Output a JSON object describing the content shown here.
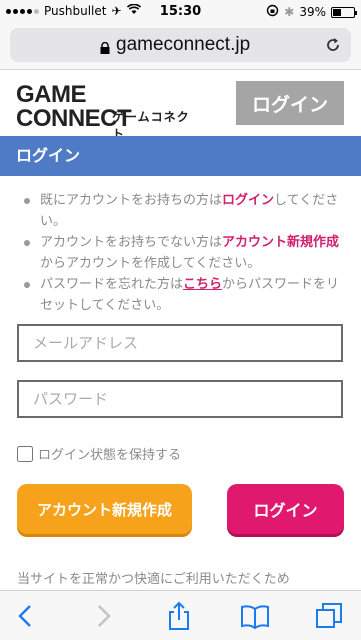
{
  "status_bar": {
    "carrier": "Pushbullet",
    "time": "15:30",
    "battery": "39%",
    "battery_level": 0.39
  },
  "browser": {
    "url": "gameconnect.jp"
  },
  "site": {
    "logo_text": "GAME CONNECT",
    "logo_subtext": "ゲームコネクト",
    "header_login_label": "ログイン"
  },
  "page": {
    "section_title": "ログイン",
    "info": [
      {
        "before": "既にアカウントをお持ちの方は",
        "link": "ログイン",
        "after": "してください。"
      },
      {
        "before": "アカウントをお持ちでない方は",
        "link": "アカウント新規作成",
        "after": "からアカウントを作成してください。"
      },
      {
        "before": "パスワードを忘れた方は",
        "link": "こちら",
        "after": "からパスワードをリセットしてください。"
      }
    ],
    "email_placeholder": "メールアドレス",
    "password_placeholder": "パスワード",
    "remember_label": "ログイン状態を保持する",
    "create_account_label": "アカウント新規作成",
    "login_label": "ログイン",
    "notice": "当サイトを正常かつ快適にご利用いただくため"
  },
  "colors": {
    "title_bar": "#4f7bc6",
    "link": "#d0206f",
    "create_button": "#f6a21b",
    "login_button": "#e0196f",
    "header_login_button": "#a5a5a5"
  },
  "icons": {
    "back": "chevron-left-icon",
    "forward": "chevron-right-icon",
    "share": "share-icon",
    "bookmarks": "book-icon",
    "tabs": "tabs-icon"
  }
}
